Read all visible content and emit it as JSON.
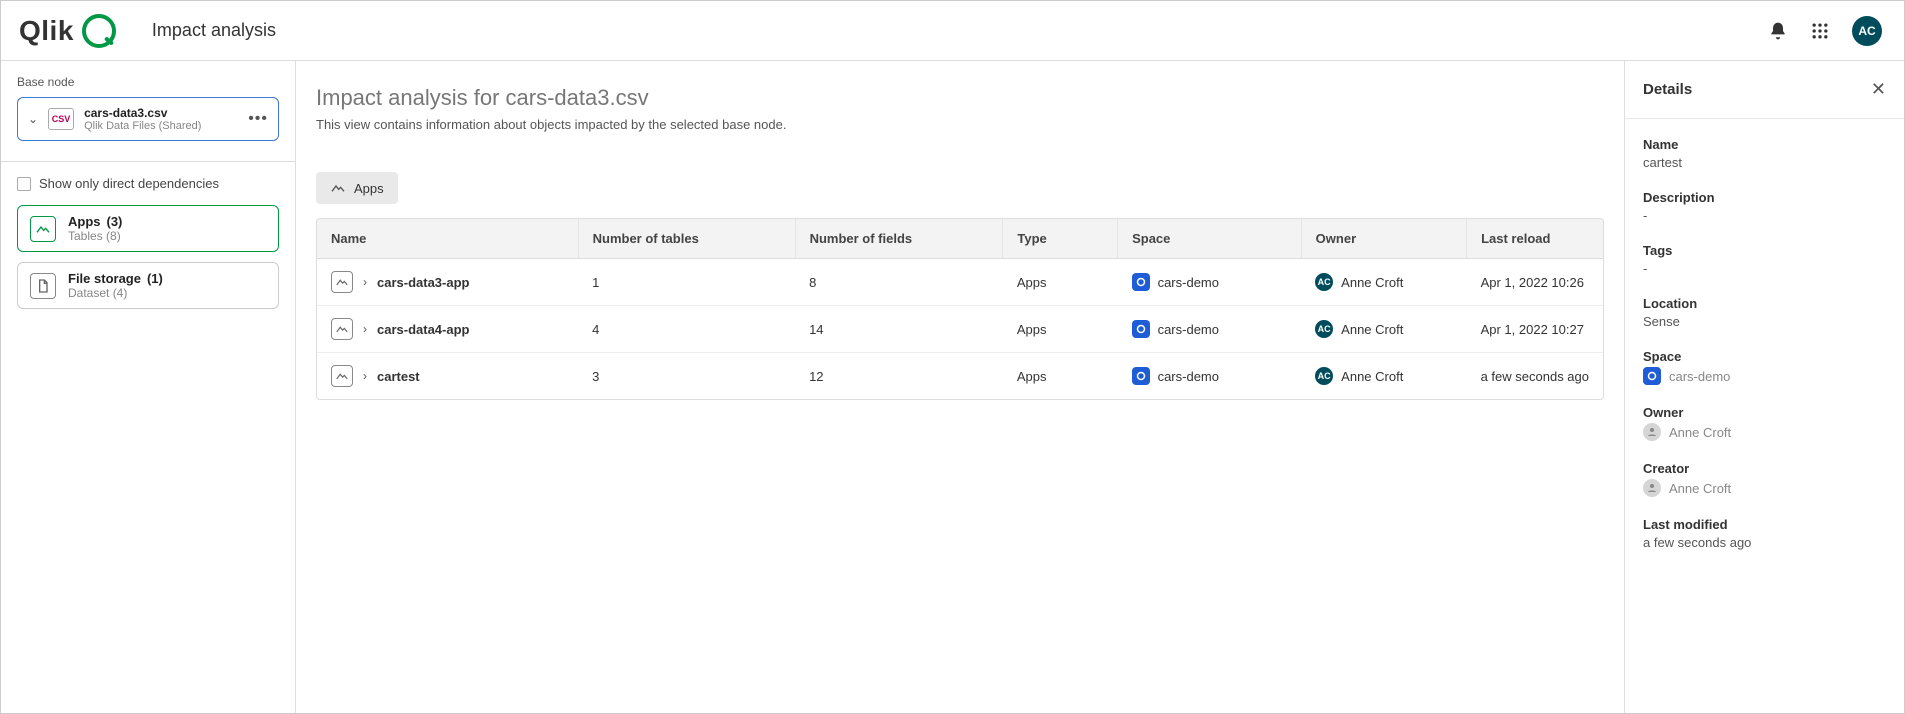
{
  "header": {
    "brand": "Qlik",
    "page_title": "Impact analysis",
    "avatar_initials": "AC"
  },
  "sidebar": {
    "base_node_label": "Base node",
    "base_node": {
      "name": "cars-data3.csv",
      "subtitle": "Qlik Data Files (Shared)"
    },
    "show_only_direct": "Show only direct dependencies",
    "categories": [
      {
        "title": "Apps",
        "count": "(3)",
        "sub": "Tables (8)",
        "selected": true
      },
      {
        "title": "File storage",
        "count": "(1)",
        "sub": "Dataset (4)",
        "selected": false
      }
    ]
  },
  "content": {
    "heading": "Impact analysis for cars-data3.csv",
    "subheading": "This view contains information about objects impacted by the selected base node.",
    "tab_label": "Apps",
    "columns": [
      "Name",
      "Number of tables",
      "Number of fields",
      "Type",
      "Space",
      "Owner",
      "Last reload"
    ],
    "rows": [
      {
        "name": "cars-data3-app",
        "tables": "1",
        "fields": "8",
        "type": "Apps",
        "space": "cars-demo",
        "owner": "Anne Croft",
        "owner_initials": "AC",
        "last_reload": "Apr 1, 2022 10:26"
      },
      {
        "name": "cars-data4-app",
        "tables": "4",
        "fields": "14",
        "type": "Apps",
        "space": "cars-demo",
        "owner": "Anne Croft",
        "owner_initials": "AC",
        "last_reload": "Apr 1, 2022 10:27"
      },
      {
        "name": "cartest",
        "tables": "3",
        "fields": "12",
        "type": "Apps",
        "space": "cars-demo",
        "owner": "Anne Croft",
        "owner_initials": "AC",
        "last_reload": "a few seconds ago"
      }
    ]
  },
  "details": {
    "panel_title": "Details",
    "name_label": "Name",
    "name_value": "cartest",
    "description_label": "Description",
    "description_value": "-",
    "tags_label": "Tags",
    "tags_value": "-",
    "location_label": "Location",
    "location_value": "Sense",
    "space_label": "Space",
    "space_value": "cars-demo",
    "owner_label": "Owner",
    "owner_value": "Anne Croft",
    "creator_label": "Creator",
    "creator_value": "Anne Croft",
    "last_modified_label": "Last modified",
    "last_modified_value": "a few seconds ago"
  }
}
